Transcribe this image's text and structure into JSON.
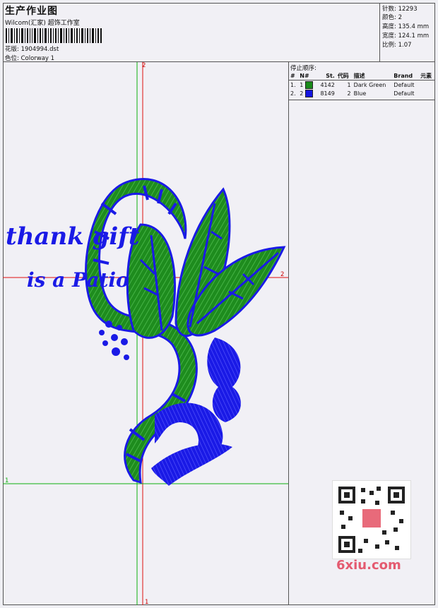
{
  "header": {
    "title": "生产作业图",
    "subtitle": "Wilcom(汇家) 超饰工作室",
    "design_label": "花版:",
    "design_value": "1904994.dst",
    "colorway_label": "色位:",
    "colorway_value": "Colorway 1"
  },
  "stats": [
    {
      "label": "针数:",
      "value": "12293"
    },
    {
      "label": "颜色:",
      "value": "2"
    },
    {
      "label": "高度:",
      "value": "135.4 mm"
    },
    {
      "label": "宽度:",
      "value": "124.1 mm"
    },
    {
      "label": "比例:",
      "value": "1.07"
    }
  ],
  "stop_sequence": {
    "title": "停止顺序:",
    "headers": {
      "num": "#",
      "n": "N#",
      "st": "St.",
      "code": "代码",
      "desc": "描述",
      "brand": "Brand",
      "element": "元素"
    },
    "rows": [
      {
        "num": "1.",
        "n": "1",
        "st": "4142",
        "code": "1",
        "desc": "Dark Green",
        "brand": "Default",
        "color": "#1a8a1a"
      },
      {
        "num": "2.",
        "n": "2",
        "st": "8149",
        "code": "2",
        "desc": "Blue",
        "brand": "Default",
        "color": "#1515e0"
      }
    ]
  },
  "guides": {
    "h1": "1",
    "h2": "2",
    "v1": "1",
    "v2": "2"
  },
  "artwork_text": {
    "line1": "thank gift",
    "line2": "is a Patio"
  },
  "watermark": "6xiu.com",
  "colors": {
    "green": "#1e8c1e",
    "blue": "#1a1ae6",
    "guide_red": "#e01010",
    "guide_green": "#10b010"
  }
}
